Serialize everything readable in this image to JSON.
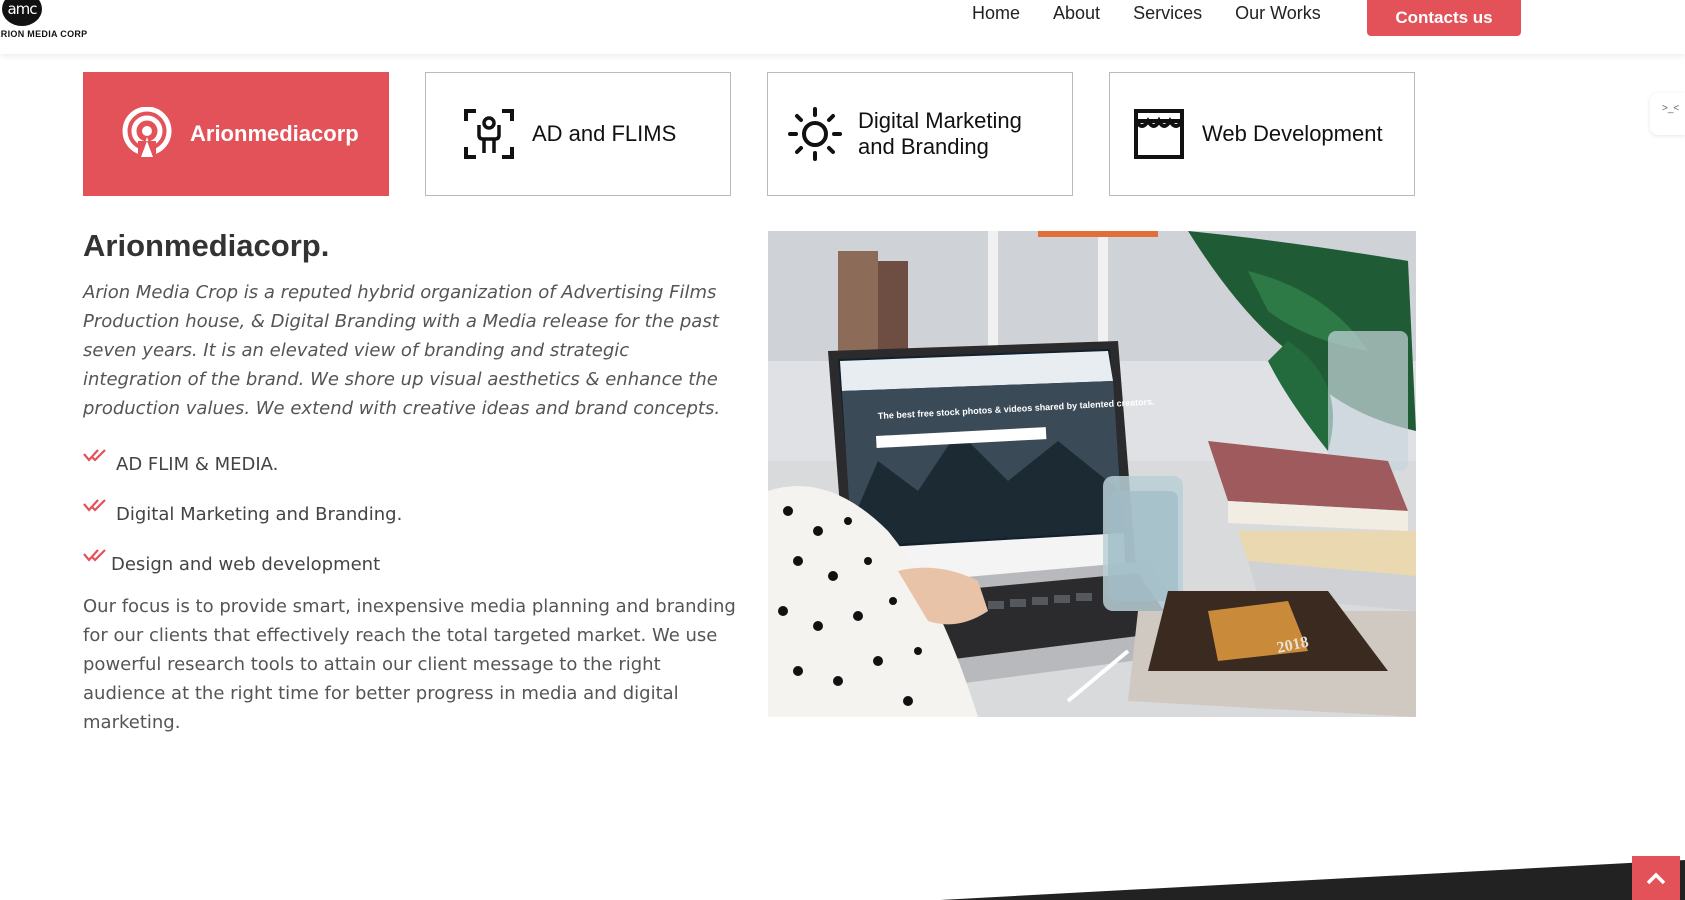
{
  "header": {
    "logo_mark": "amc",
    "logo_text": "ARION MEDIA CORP",
    "nav": [
      {
        "label": "Home"
      },
      {
        "label": "About"
      },
      {
        "label": "Services"
      },
      {
        "label": "Our Works"
      }
    ],
    "cta_label": "Contacts us"
  },
  "tabs": [
    {
      "label": "Arionmediacorp",
      "icon": "broadcast-icon",
      "active": true
    },
    {
      "label": "AD and FLIMS",
      "icon": "person-focus-icon",
      "active": false
    },
    {
      "label": "Digital Marketing and Branding",
      "icon": "sun-icon",
      "active": false
    },
    {
      "label": "Web Development",
      "icon": "storefront-icon",
      "active": false
    }
  ],
  "content": {
    "title": "Arionmediacorp.",
    "intro": "Arion Media Crop is a reputed hybrid organization of Advertising Films Production house, & Digital Branding with a Media release for the past seven years. It is an elevated view of branding and strategic integration of the brand. We shore up visual aesthetics & enhance the production values. We extend with creative ideas and brand concepts.",
    "features": [
      "AD FLIM & MEDIA.",
      "Digital Marketing and Branding.",
      "Design and web development"
    ],
    "body": "Our focus is to provide smart, inexpensive media planning and branding for our clients that effectively reach the total targeted market. We use powerful research tools to attain our client message to the right audience at the right time for better progress in media and digital marketing."
  },
  "photo": {
    "screen_headline": "The best free stock photos & videos shared by talented creators.",
    "book_year": "2018"
  },
  "side_widget": {
    "label": ">_<"
  },
  "colors": {
    "accent": "#e35259",
    "text": "#444444",
    "footer": "#222222"
  }
}
